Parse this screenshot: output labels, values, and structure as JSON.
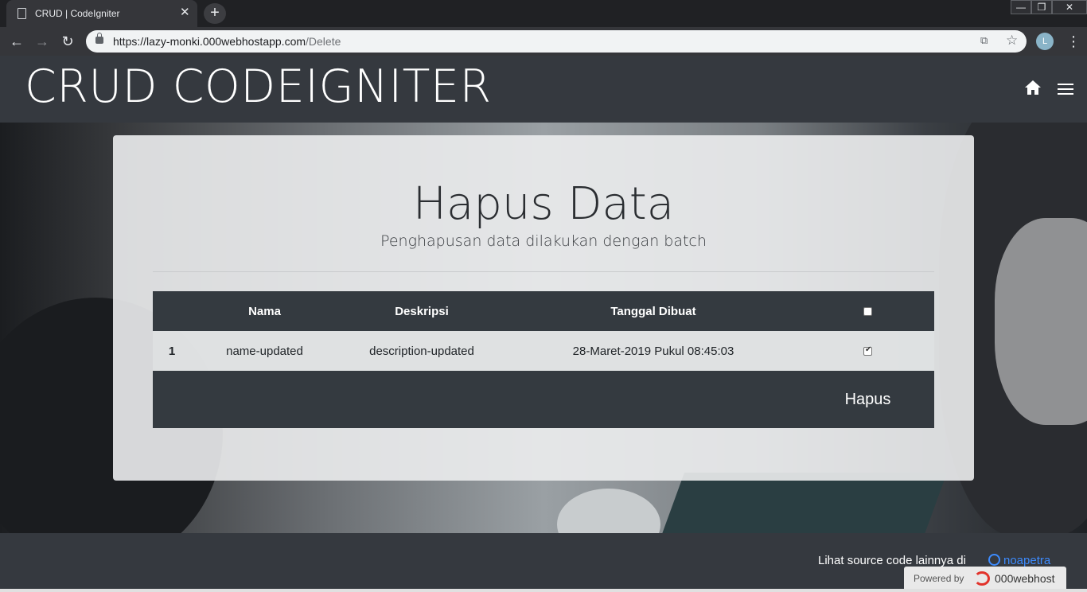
{
  "browser": {
    "tab_title": "CRUD | CodeIgniter",
    "tab_close": "✕",
    "new_tab": "+",
    "url_host": "https://lazy-monki.000webhostapp.com",
    "url_path": "/Delete",
    "profile_initial": "L",
    "window_min": "—",
    "window_max": "❐",
    "window_close": "✕"
  },
  "header": {
    "brand": "CRUD CODEIGNITER"
  },
  "card": {
    "title": "Hapus Data",
    "subtitle": "Penghapusan data dilakukan dengan batch"
  },
  "table": {
    "columns": [
      "",
      "Nama",
      "Deskripsi",
      "Tanggal Dibuat"
    ],
    "select_all_checked": false,
    "rows": [
      {
        "no": "1",
        "nama": "name-updated",
        "deskripsi": "description-updated",
        "tanggal": "28-Maret-2019 Pukul 08:45:03",
        "checked": true
      }
    ],
    "delete_label": "Hapus"
  },
  "footer": {
    "text": "Lihat source code lainnya di",
    "github_user": "noapetra",
    "powered_label": "Powered by",
    "powered_brand": "000webhost"
  },
  "icons": {
    "home": "home-icon",
    "menu": "hamburger-menu-icon"
  },
  "colors": {
    "header_bg": "#35393f",
    "table_header_bg": "#343a40",
    "link": "#3d8bfd"
  }
}
